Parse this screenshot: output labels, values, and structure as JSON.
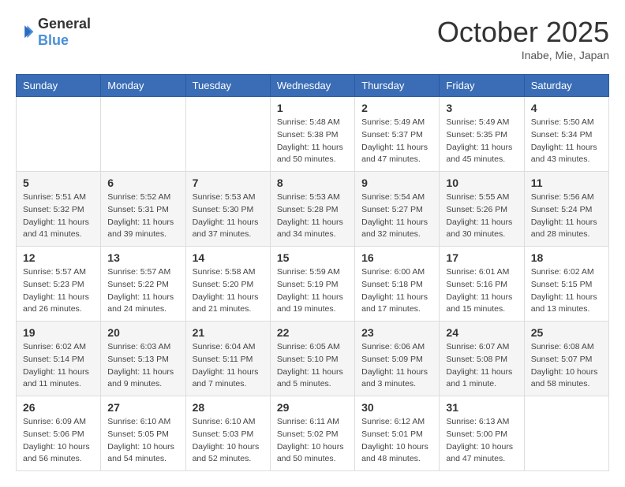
{
  "logo": {
    "general": "General",
    "blue": "Blue"
  },
  "header": {
    "month": "October 2025",
    "location": "Inabe, Mie, Japan"
  },
  "weekdays": [
    "Sunday",
    "Monday",
    "Tuesday",
    "Wednesday",
    "Thursday",
    "Friday",
    "Saturday"
  ],
  "weeks": [
    [
      {
        "day": "",
        "info": ""
      },
      {
        "day": "",
        "info": ""
      },
      {
        "day": "",
        "info": ""
      },
      {
        "day": "1",
        "info": "Sunrise: 5:48 AM\nSunset: 5:38 PM\nDaylight: 11 hours\nand 50 minutes."
      },
      {
        "day": "2",
        "info": "Sunrise: 5:49 AM\nSunset: 5:37 PM\nDaylight: 11 hours\nand 47 minutes."
      },
      {
        "day": "3",
        "info": "Sunrise: 5:49 AM\nSunset: 5:35 PM\nDaylight: 11 hours\nand 45 minutes."
      },
      {
        "day": "4",
        "info": "Sunrise: 5:50 AM\nSunset: 5:34 PM\nDaylight: 11 hours\nand 43 minutes."
      }
    ],
    [
      {
        "day": "5",
        "info": "Sunrise: 5:51 AM\nSunset: 5:32 PM\nDaylight: 11 hours\nand 41 minutes."
      },
      {
        "day": "6",
        "info": "Sunrise: 5:52 AM\nSunset: 5:31 PM\nDaylight: 11 hours\nand 39 minutes."
      },
      {
        "day": "7",
        "info": "Sunrise: 5:53 AM\nSunset: 5:30 PM\nDaylight: 11 hours\nand 37 minutes."
      },
      {
        "day": "8",
        "info": "Sunrise: 5:53 AM\nSunset: 5:28 PM\nDaylight: 11 hours\nand 34 minutes."
      },
      {
        "day": "9",
        "info": "Sunrise: 5:54 AM\nSunset: 5:27 PM\nDaylight: 11 hours\nand 32 minutes."
      },
      {
        "day": "10",
        "info": "Sunrise: 5:55 AM\nSunset: 5:26 PM\nDaylight: 11 hours\nand 30 minutes."
      },
      {
        "day": "11",
        "info": "Sunrise: 5:56 AM\nSunset: 5:24 PM\nDaylight: 11 hours\nand 28 minutes."
      }
    ],
    [
      {
        "day": "12",
        "info": "Sunrise: 5:57 AM\nSunset: 5:23 PM\nDaylight: 11 hours\nand 26 minutes."
      },
      {
        "day": "13",
        "info": "Sunrise: 5:57 AM\nSunset: 5:22 PM\nDaylight: 11 hours\nand 24 minutes."
      },
      {
        "day": "14",
        "info": "Sunrise: 5:58 AM\nSunset: 5:20 PM\nDaylight: 11 hours\nand 21 minutes."
      },
      {
        "day": "15",
        "info": "Sunrise: 5:59 AM\nSunset: 5:19 PM\nDaylight: 11 hours\nand 19 minutes."
      },
      {
        "day": "16",
        "info": "Sunrise: 6:00 AM\nSunset: 5:18 PM\nDaylight: 11 hours\nand 17 minutes."
      },
      {
        "day": "17",
        "info": "Sunrise: 6:01 AM\nSunset: 5:16 PM\nDaylight: 11 hours\nand 15 minutes."
      },
      {
        "day": "18",
        "info": "Sunrise: 6:02 AM\nSunset: 5:15 PM\nDaylight: 11 hours\nand 13 minutes."
      }
    ],
    [
      {
        "day": "19",
        "info": "Sunrise: 6:02 AM\nSunset: 5:14 PM\nDaylight: 11 hours\nand 11 minutes."
      },
      {
        "day": "20",
        "info": "Sunrise: 6:03 AM\nSunset: 5:13 PM\nDaylight: 11 hours\nand 9 minutes."
      },
      {
        "day": "21",
        "info": "Sunrise: 6:04 AM\nSunset: 5:11 PM\nDaylight: 11 hours\nand 7 minutes."
      },
      {
        "day": "22",
        "info": "Sunrise: 6:05 AM\nSunset: 5:10 PM\nDaylight: 11 hours\nand 5 minutes."
      },
      {
        "day": "23",
        "info": "Sunrise: 6:06 AM\nSunset: 5:09 PM\nDaylight: 11 hours\nand 3 minutes."
      },
      {
        "day": "24",
        "info": "Sunrise: 6:07 AM\nSunset: 5:08 PM\nDaylight: 11 hours\nand 1 minute."
      },
      {
        "day": "25",
        "info": "Sunrise: 6:08 AM\nSunset: 5:07 PM\nDaylight: 10 hours\nand 58 minutes."
      }
    ],
    [
      {
        "day": "26",
        "info": "Sunrise: 6:09 AM\nSunset: 5:06 PM\nDaylight: 10 hours\nand 56 minutes."
      },
      {
        "day": "27",
        "info": "Sunrise: 6:10 AM\nSunset: 5:05 PM\nDaylight: 10 hours\nand 54 minutes."
      },
      {
        "day": "28",
        "info": "Sunrise: 6:10 AM\nSunset: 5:03 PM\nDaylight: 10 hours\nand 52 minutes."
      },
      {
        "day": "29",
        "info": "Sunrise: 6:11 AM\nSunset: 5:02 PM\nDaylight: 10 hours\nand 50 minutes."
      },
      {
        "day": "30",
        "info": "Sunrise: 6:12 AM\nSunset: 5:01 PM\nDaylight: 10 hours\nand 48 minutes."
      },
      {
        "day": "31",
        "info": "Sunrise: 6:13 AM\nSunset: 5:00 PM\nDaylight: 10 hours\nand 47 minutes."
      },
      {
        "day": "",
        "info": ""
      }
    ]
  ]
}
